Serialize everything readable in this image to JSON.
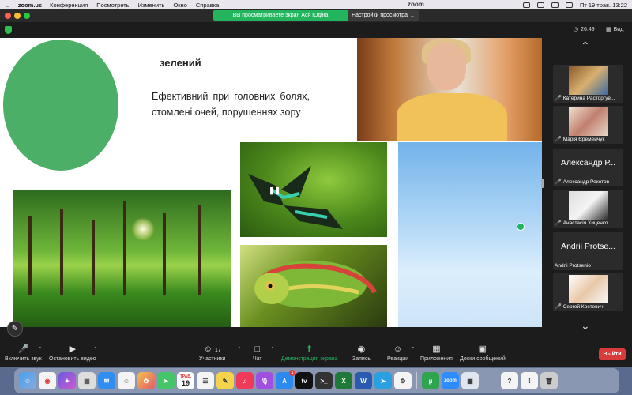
{
  "menubar": {
    "app": "zoom.us",
    "items": [
      "Конференция",
      "Посмотреть",
      "Изменить",
      "Окно",
      "Справка"
    ],
    "center_logo": "zoom",
    "datetime": "Пт 19 трав.  13:22"
  },
  "share_banner": {
    "text": "Вы просматриваете экран Ася Юдіна",
    "options": "Настройки просмотра"
  },
  "topbar": {
    "timer": "26:49",
    "view_label": "Вид"
  },
  "slide": {
    "title": "зелений",
    "body": "Ефективний при головних болях, стомлені очей, порушеннях зору"
  },
  "participants": [
    {
      "name": "Катерина Расторгуе...",
      "muted": true,
      "type": "video"
    },
    {
      "name": "Марія Єремейчук",
      "muted": true,
      "type": "video"
    },
    {
      "big": "Александр Р...",
      "name": "Александр Рекотов",
      "muted": true,
      "type": "name"
    },
    {
      "name": "Анастасія Хиценко",
      "muted": true,
      "type": "video"
    },
    {
      "big": "Andrii Protse...",
      "name": "Andrii Protsenio",
      "muted": false,
      "type": "name"
    },
    {
      "name": "Сергей Костевич",
      "muted": true,
      "type": "video"
    }
  ],
  "toolbar": {
    "unmute": "Включить звук",
    "video": "Остановить видео",
    "participants": "Участники",
    "participants_count": "17",
    "chat": "Чат",
    "share": "Демонстрация экрана",
    "record": "Запись",
    "reactions": "Реакции",
    "apps": "Приложения",
    "whiteboards": "Доски сообщений",
    "leave": "Выйти"
  },
  "dock": {
    "calendar_day": "19",
    "calendar_month": "ТРАВ.",
    "zoom_label": "zoom",
    "badge": "1"
  },
  "colors": {
    "share_green": "#23b55e",
    "leave_red": "#d93a3a",
    "slide_circle": "#4caf68"
  }
}
